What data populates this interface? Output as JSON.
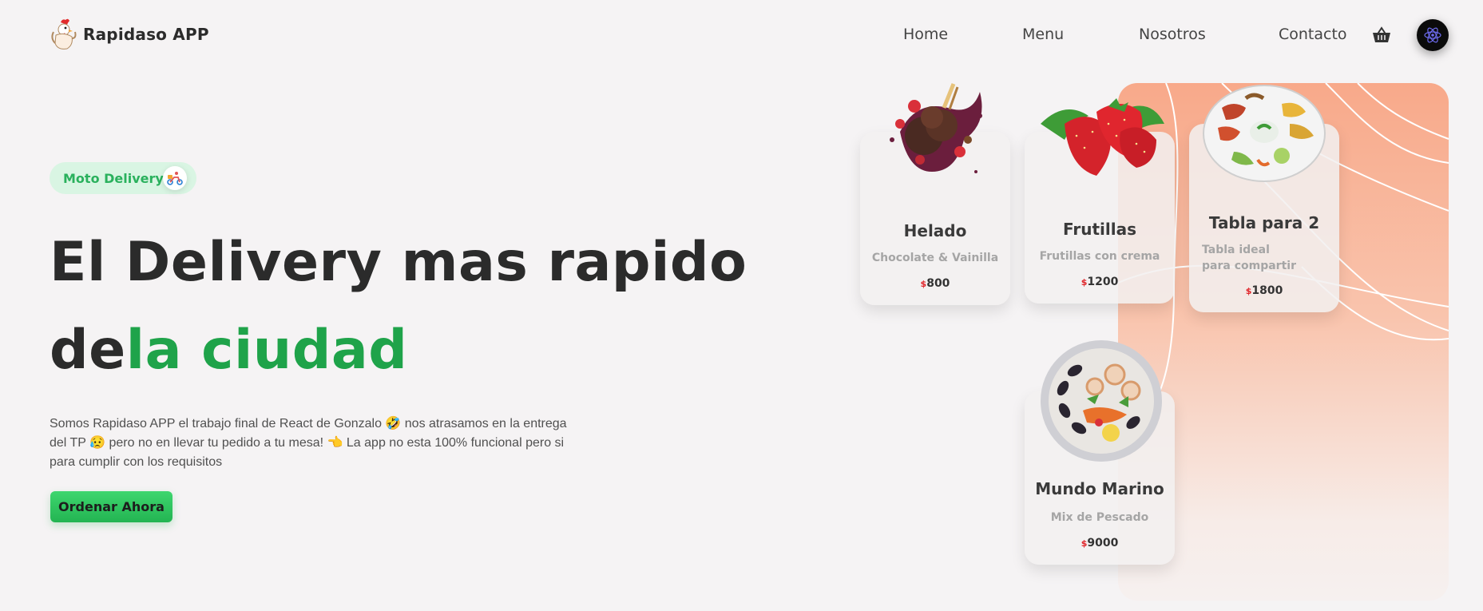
{
  "brand": {
    "name": "Rapidaso APP"
  },
  "nav": {
    "items": [
      "Home",
      "Menu",
      "Nosotros",
      "Contacto"
    ]
  },
  "icons": {
    "cart": "basket-icon",
    "avatar": "react-logo-icon",
    "badge": "scooter-icon",
    "logo": "rooster-logo-icon"
  },
  "hero": {
    "badge": "Moto Delivery",
    "headline_line1": "El Delivery mas rapido",
    "headline_line2_dark": "de",
    "headline_line2_green": "la ciudad",
    "description": "Somos Rapidaso APP el trabajo final de React de Gonzalo 🤣 nos atrasamos en la entrega del TP 😥 pero no en llevar tu pedido a tu mesa! 👈 La app no esta 100% funcional pero si para cumplir con los requisitos",
    "cta": "Ordenar Ahora"
  },
  "colors": {
    "accent_green": "#1fa34a",
    "panel_top": "#f8a98a",
    "currency": "#e0262b"
  },
  "products": [
    {
      "name": "Helado",
      "description": "Chocolate & Vainilla",
      "currency": "$",
      "price": "800",
      "image": "ice-cream-image"
    },
    {
      "name": "Frutillas",
      "description": "Frutillas con crema",
      "currency": "$",
      "price": "1200",
      "image": "strawberries-image"
    },
    {
      "name": "Tabla para 2",
      "description": "Tabla ideal para compartir",
      "currency": "$",
      "price": "1800",
      "image": "platter-image"
    },
    {
      "name": "Mundo Marino",
      "description": "Mix de Pescado",
      "currency": "$",
      "price": "9000",
      "image": "seafood-image"
    }
  ]
}
